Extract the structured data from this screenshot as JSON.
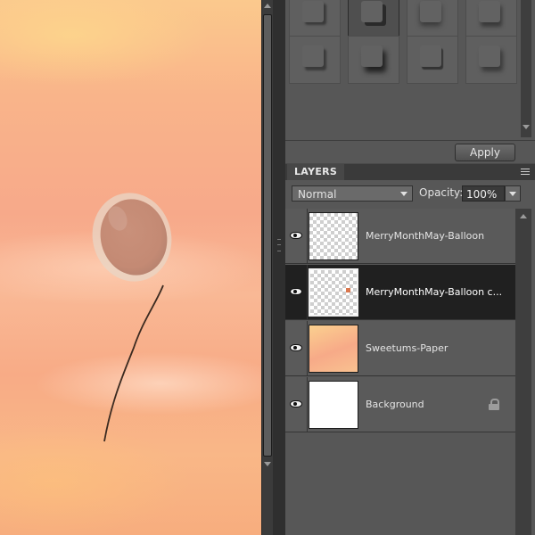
{
  "styles_panel": {
    "apply_label": "Apply",
    "effect_tiles": [
      "style-1",
      "style-2",
      "style-3",
      "style-4",
      "style-5",
      "style-6",
      "style-7",
      "style-8"
    ]
  },
  "layers_panel": {
    "tab_label": "LAYERS",
    "blend_mode": "Normal",
    "opacity_label": "Opacity:",
    "opacity_value": "100%",
    "layers": [
      {
        "name": "MerryMonthMay-Balloon",
        "thumbnail": "transparent",
        "visible": true,
        "selected": false,
        "locked": false
      },
      {
        "name": "MerryMonthMay-Balloon c...",
        "thumbnail": "transparent-dot",
        "visible": true,
        "selected": true,
        "locked": false
      },
      {
        "name": "Sweetums-Paper",
        "thumbnail": "paper",
        "visible": true,
        "selected": false,
        "locked": false
      },
      {
        "name": "Background",
        "thumbnail": "white",
        "visible": true,
        "selected": false,
        "locked": true
      }
    ]
  },
  "colors": {
    "canvas_paper": "#f8ae88",
    "balloon": "#c9907a",
    "panel_bg": "#575757",
    "selected_row": "#202020"
  }
}
